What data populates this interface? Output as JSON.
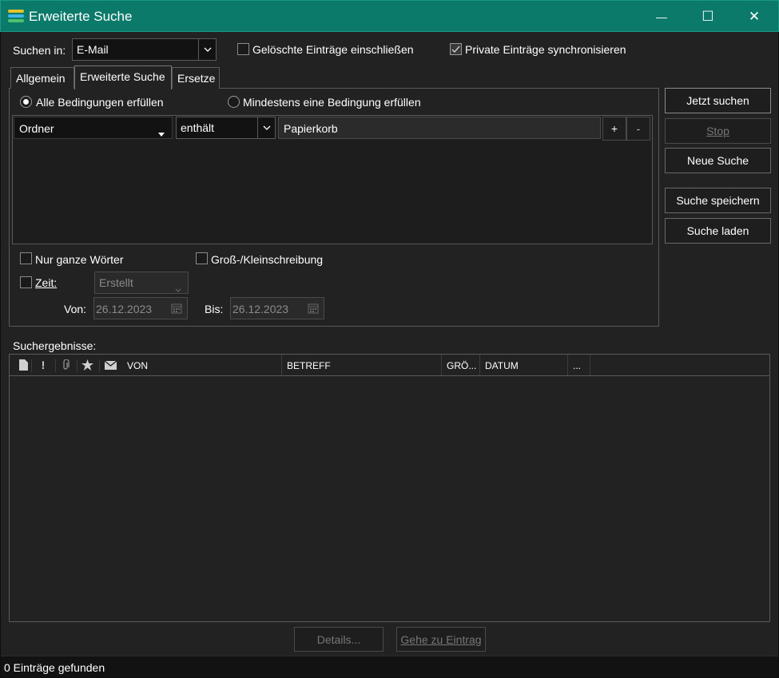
{
  "window": {
    "title": "Erweiterte Suche",
    "minimize_glyph": "—",
    "maximize_glyph": "☐",
    "close_glyph": "✕",
    "accent_color": "#0b7a6b"
  },
  "search_in": {
    "label": "Suchen in:",
    "value": "E-Mail"
  },
  "options": {
    "include_deleted": {
      "label": "Gelöschte Einträge einschließen",
      "checked": false
    },
    "sync_private": {
      "label": "Private Einträge synchronisieren",
      "checked": true
    }
  },
  "tabs": [
    {
      "label": "Allgemein",
      "active": false
    },
    {
      "label": "Erweiterte Suche",
      "active": true
    },
    {
      "label": "Ersetze",
      "active": false
    }
  ],
  "match_mode": {
    "all_label": "Alle Bedingungen erfüllen",
    "any_label": "Mindestens eine Bedingung erfüllen",
    "selected": "all"
  },
  "condition": {
    "field": "Ordner",
    "operator": "enthält",
    "value": "Papierkorb",
    "add_label": "+",
    "remove_label": "-"
  },
  "filters": {
    "whole_words": {
      "label": "Nur ganze Wörter",
      "checked": false
    },
    "case_sensitive": {
      "label": "Groß-/Kleinschreibung",
      "checked": false
    },
    "time": {
      "label": "Zeit:",
      "checked": false,
      "type_value": "Erstellt"
    },
    "from_label": "Von:",
    "from_date": "26.12.2023",
    "to_label": "Bis:",
    "to_date": "26.12.2023"
  },
  "actions": {
    "search_now": "Jetzt suchen",
    "stop": "Stop",
    "new_search": "Neue Suche",
    "save_search": "Suche speichern",
    "load_search": "Suche laden"
  },
  "results": {
    "label": "Suchergebnisse:",
    "columns": [
      "VON",
      "BETREFF",
      "GRÖ...",
      "DATUM",
      "..."
    ],
    "icon_columns": [
      "document-icon",
      "priority-icon",
      "attachment-icon",
      "star-icon",
      "envelope-icon"
    ],
    "rows": []
  },
  "bottom_buttons": {
    "details": "Details...",
    "goto": "Gehe zu Eintrag"
  },
  "status": {
    "text": "0 Einträge gefunden"
  }
}
